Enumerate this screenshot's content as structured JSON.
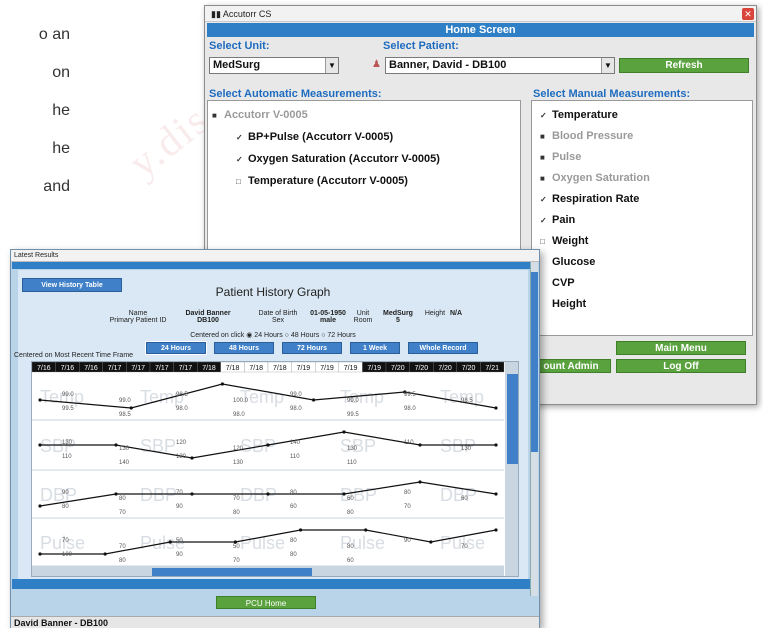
{
  "background": {
    "text_lines": [
      "o an",
      "on",
      "he",
      "he",
      "and"
    ],
    "watermark": "y.discou"
  },
  "main_window": {
    "title": "Accutorr CS",
    "header": "Home Screen",
    "select_unit_label": "Select Unit:",
    "unit_value": "MedSurg",
    "select_patient_label": "Select Patient:",
    "patient_value": "Banner, David - DB100",
    "refresh_label": "Refresh",
    "auto_label": "Select Automatic Measurements:",
    "auto_device": "Accutorr V-0005",
    "auto_items": [
      {
        "label": "BP+Pulse (Accutorr V-0005)",
        "check": "✓"
      },
      {
        "label": "Oxygen Saturation (Accutorr V-0005)",
        "check": "✓"
      },
      {
        "label": "Temperature (Accutorr V-0005)",
        "check": "□"
      }
    ],
    "manual_label": "Select Manual Measurements:",
    "manual_items": [
      {
        "label": "Temperature",
        "check": "✓",
        "disabled": false
      },
      {
        "label": "Blood Pressure",
        "check": "■",
        "disabled": true
      },
      {
        "label": "Pulse",
        "check": "■",
        "disabled": true
      },
      {
        "label": "Oxygen Saturation",
        "check": "■",
        "disabled": true
      },
      {
        "label": "Respiration Rate",
        "check": "✓",
        "disabled": false
      },
      {
        "label": "Pain",
        "check": "✓",
        "disabled": false
      },
      {
        "label": "Weight",
        "check": "□",
        "disabled": false
      },
      {
        "label": "Glucose",
        "check": "",
        "disabled": false
      },
      {
        "label": "CVP",
        "check": "",
        "disabled": false
      },
      {
        "label": "Height",
        "check": "",
        "disabled": false
      }
    ],
    "main_menu_label": "Main Menu",
    "account_admin_label": "ount Admin",
    "log_off_label": "Log Off"
  },
  "results_window": {
    "title": "Latest Results",
    "view_history_label": "View History Table",
    "graph_title": "Patient History Graph",
    "info": {
      "name_label": "Name",
      "name_value": "David Banner",
      "pid_label": "Primary Patient ID",
      "pid_value": "DB100",
      "dob_label": "Date of Birth",
      "dob_value": "01-05-1950",
      "sex_label": "Sex",
      "sex_value": "male",
      "unit_label": "Unit",
      "unit_value": "MedSurg",
      "room_label": "Room",
      "room_value": "5",
      "height_label": "Height",
      "height_value": "N/A"
    },
    "centered_label": "Centered on click",
    "centered_options": [
      "24 Hours",
      "48 Hours",
      "72 Hours"
    ],
    "recent_label": "Centered on Most Recent Time Frame",
    "range_buttons": [
      "24 Hours",
      "48 Hours",
      "72 Hours",
      "1 Week",
      "Whole Record"
    ],
    "pcu_home_label": "PCU Home",
    "footer": "David Banner - DB100"
  },
  "chart_data": {
    "type": "line",
    "x": [
      "7/16",
      "7/16",
      "7/16",
      "7/17",
      "7/17",
      "7/17",
      "7/17",
      "7/18",
      "7/18",
      "7/18",
      "7/18",
      "7/19",
      "7/19",
      "7/19",
      "7/19",
      "7/20",
      "7/20",
      "7/20",
      "7/20",
      "7/21"
    ],
    "series": [
      {
        "name": "Temp",
        "values": [
          99.0,
          98.5,
          100.0,
          99.0,
          99.5,
          98.5
        ]
      },
      {
        "name": "SBP",
        "values": [
          130,
          130,
          120,
          130,
          140,
          130,
          130
        ]
      },
      {
        "name": "DBP",
        "values": [
          70,
          80,
          80,
          80,
          80,
          90,
          80
        ]
      },
      {
        "name": "Pulse",
        "values": [
          70,
          70,
          80,
          80,
          90,
          90,
          80,
          90
        ]
      }
    ]
  },
  "chart_labels": {
    "temp": [
      "99.0",
      "99.0",
      "98.5",
      "100.0",
      "99.0",
      "99.0",
      "99.5",
      "98.5",
      "99.5",
      "98.5",
      "98.0",
      "98.0",
      "98.0",
      "99.5",
      "98.0"
    ],
    "sbp": [
      "130",
      "130",
      "120",
      "120",
      "140",
      "130",
      "110",
      "130",
      "110",
      "140",
      "130",
      "130",
      "110",
      "110"
    ],
    "dbp": [
      "90",
      "80",
      "70",
      "70",
      "80",
      "60",
      "80",
      "60",
      "80",
      "70",
      "90",
      "80",
      "60",
      "80",
      "70"
    ],
    "pulse": [
      "70",
      "70",
      "50",
      "50",
      "80",
      "80",
      "90",
      "70",
      "100",
      "80",
      "90",
      "70",
      "80",
      "60"
    ]
  },
  "colors": {
    "accent_blue": "#2f7fc6",
    "green": "#5aa23e",
    "panel_bg": "#b9d4e8"
  }
}
